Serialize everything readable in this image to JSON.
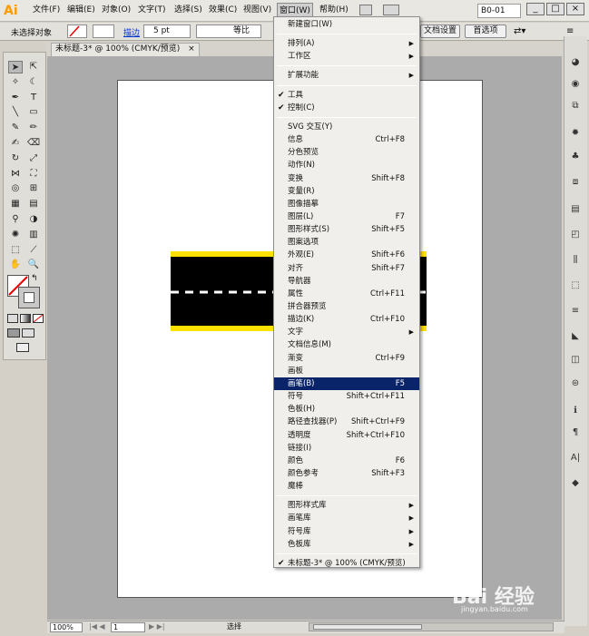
{
  "app": {
    "logo_text": "Ai",
    "window_id": "B0-01"
  },
  "menus": [
    "文件(F)",
    "编辑(E)",
    "对象(O)",
    "文字(T)",
    "选择(S)",
    "效果(C)",
    "视图(V)",
    "窗口(W)",
    "帮助(H)"
  ],
  "control": {
    "selection_label": "未选择对象",
    "stroke_label": "描边",
    "stroke_weight": "5 pt",
    "stroke_profile": "等比",
    "doc_setup": "文档设置",
    "preferences": "首选项"
  },
  "doc_tab": {
    "title": "未标题-3* @ 100% (CMYK/预览)",
    "close": "×"
  },
  "status": {
    "zoom": "100%",
    "page": "1",
    "tool": "选择"
  },
  "window_menu": [
    {
      "label": "新建窗口(W)"
    },
    {
      "sep": true
    },
    {
      "label": "排列(A)",
      "submenu": true
    },
    {
      "label": "工作区",
      "submenu": true
    },
    {
      "sep": true
    },
    {
      "label": "扩展功能",
      "submenu": true
    },
    {
      "sep": true
    },
    {
      "label": "工具",
      "checked": true
    },
    {
      "label": "控制(C)",
      "checked": true
    },
    {
      "sep": true
    },
    {
      "label": "SVG 交互(Y)"
    },
    {
      "label": "信息",
      "shortcut": "Ctrl+F8"
    },
    {
      "label": "分色预览"
    },
    {
      "label": "动作(N)"
    },
    {
      "label": "变换",
      "shortcut": "Shift+F8"
    },
    {
      "label": "变量(R)"
    },
    {
      "label": "图像描摹"
    },
    {
      "label": "图层(L)",
      "shortcut": "F7"
    },
    {
      "label": "图形样式(S)",
      "shortcut": "Shift+F5"
    },
    {
      "label": "图案选项"
    },
    {
      "label": "外观(E)",
      "shortcut": "Shift+F6"
    },
    {
      "label": "对齐",
      "shortcut": "Shift+F7"
    },
    {
      "label": "导航器"
    },
    {
      "label": "属性",
      "shortcut": "Ctrl+F11"
    },
    {
      "label": "拼合器预览"
    },
    {
      "label": "描边(K)",
      "shortcut": "Ctrl+F10"
    },
    {
      "label": "文字",
      "submenu": true
    },
    {
      "label": "文档信息(M)"
    },
    {
      "label": "渐变",
      "shortcut": "Ctrl+F9"
    },
    {
      "label": "画板"
    },
    {
      "label": "画笔(B)",
      "shortcut": "F5",
      "highlighted": true
    },
    {
      "label": "符号",
      "shortcut": "Shift+Ctrl+F11"
    },
    {
      "label": "色板(H)"
    },
    {
      "label": "路径查找器(P)",
      "shortcut": "Shift+Ctrl+F9"
    },
    {
      "label": "透明度",
      "shortcut": "Shift+Ctrl+F10"
    },
    {
      "label": "链接(I)"
    },
    {
      "label": "颜色",
      "shortcut": "F6"
    },
    {
      "label": "颜色参考",
      "shortcut": "Shift+F3"
    },
    {
      "label": "魔棒"
    },
    {
      "sep": true
    },
    {
      "label": "图形样式库",
      "submenu": true
    },
    {
      "label": "画笔库",
      "submenu": true
    },
    {
      "label": "符号库",
      "submenu": true
    },
    {
      "label": "色板库",
      "submenu": true
    },
    {
      "sep": true
    },
    {
      "label": "未标题-3* @ 100% (CMYK/预览)",
      "checked": true
    }
  ],
  "watermark": {
    "text": "Bai 经验",
    "url": "jingyan.baidu.com"
  },
  "colors": {
    "highlight": "#0a246a",
    "road": "#000000",
    "road_edge": "#ffe100",
    "lane": "#ffffff"
  }
}
